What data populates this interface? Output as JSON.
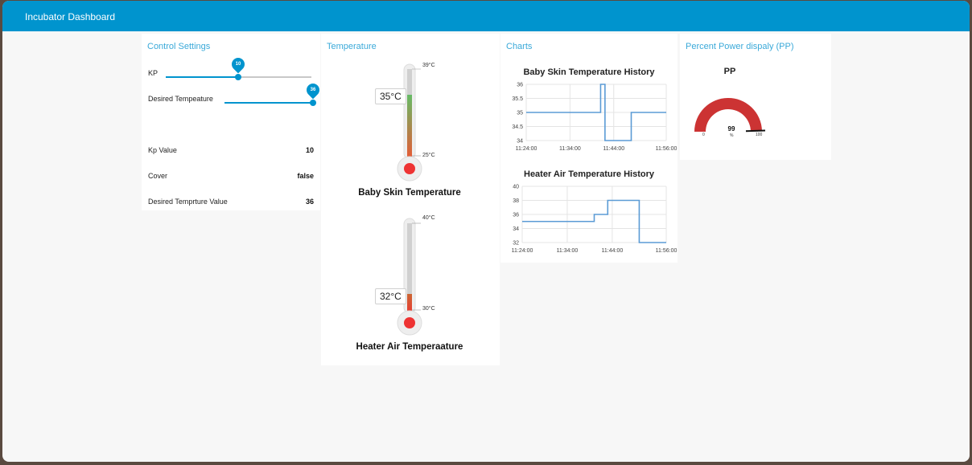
{
  "header": {
    "title": "Incubator Dashboard"
  },
  "control": {
    "title": "Control Settings",
    "kp_label": "KP",
    "kp_slider_value": "10",
    "desired_label": "Desired Tempeature",
    "desired_slider_value": "36",
    "kp_value_label": "Kp Value",
    "kp_value": "10",
    "cover_label": "Cover",
    "cover_value": "false",
    "desired_value_label": "Desired Temprture Value",
    "desired_value": "36"
  },
  "temperature": {
    "title": "Temperature",
    "baby": {
      "label": "Baby Skin Temperature",
      "value": "35°C",
      "max": "39°C",
      "min": "25°C"
    },
    "heater": {
      "label": "Heater Air Temperaature",
      "value": "32°C",
      "max": "40°C",
      "min": "30°C"
    }
  },
  "charts": {
    "title": "Charts",
    "chart_data": [
      {
        "type": "line",
        "title": "Baby Skin Temperature History",
        "yticks": [
          "36",
          "35.5",
          "35",
          "34.5",
          "34"
        ],
        "xticks": [
          "11:24:00",
          "11:34:00",
          "11:44:00",
          "11:56:00"
        ],
        "ylim": [
          34,
          36
        ],
        "x": [
          "11:24",
          "11:41",
          "11:41",
          "11:42",
          "11:42",
          "11:44",
          "11:48",
          "11:48",
          "11:48",
          "11:56"
        ],
        "y": [
          35,
          35,
          36,
          36,
          34,
          34,
          34,
          34,
          35,
          35
        ]
      },
      {
        "type": "line",
        "title": "Heater Air Temperature History",
        "yticks": [
          "40",
          "38",
          "36",
          "34",
          "32"
        ],
        "xticks": [
          "11:24:00",
          "11:34:00",
          "11:44:00",
          "11:56:00"
        ],
        "ylim": [
          32,
          40
        ],
        "x": [
          "11:24",
          "11:40",
          "11:40",
          "11:43",
          "11:43",
          "11:50",
          "11:50",
          "11:56"
        ],
        "y": [
          35,
          35,
          36,
          36,
          38,
          38,
          32,
          32
        ]
      }
    ]
  },
  "power": {
    "title": "Percent Power dispaly (PP)",
    "gauge_label": "PP",
    "value": "99",
    "percent_value": 99,
    "unit": "%",
    "min": "0",
    "max": "100",
    "color": "#cc3333"
  }
}
